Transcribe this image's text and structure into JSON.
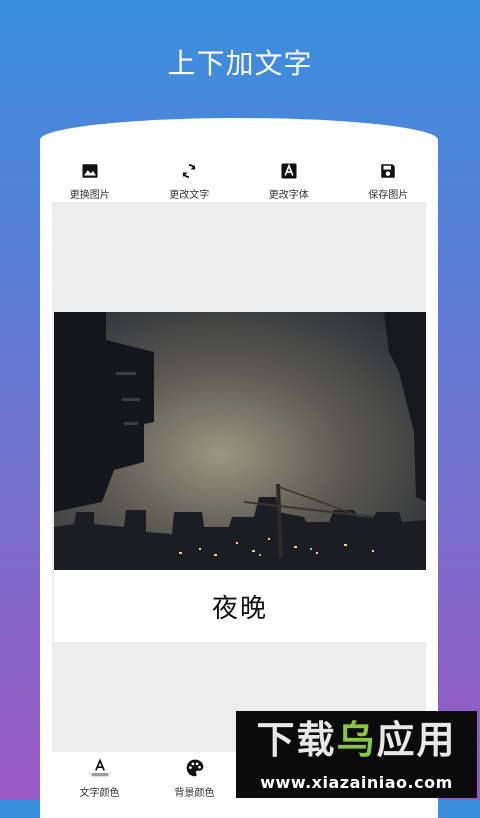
{
  "header": {
    "title": "上下加文字"
  },
  "toolbar": {
    "items": [
      {
        "label": "更换图片",
        "icon": "image-icon"
      },
      {
        "label": "更改文字",
        "icon": "refresh-icon"
      },
      {
        "label": "更改字体",
        "icon": "font-icon"
      },
      {
        "label": "保存图片",
        "icon": "save-icon"
      }
    ]
  },
  "editor": {
    "caption": "夜晚"
  },
  "bottom_bar": {
    "items": [
      {
        "label": "文字颜色",
        "icon": "text-color-icon"
      },
      {
        "label": "背景颜色",
        "icon": "palette-icon"
      }
    ]
  },
  "watermark": {
    "line1_a": "下载",
    "line1_b": "乌",
    "line1_c": "应用",
    "line2": "www.xiazainiao.com"
  },
  "colors": {
    "gradient_top": "#3a8fde",
    "gradient_bottom": "#9a58c2",
    "canvas_bg": "#ededed",
    "watermark_accent": "#8cc63e"
  }
}
